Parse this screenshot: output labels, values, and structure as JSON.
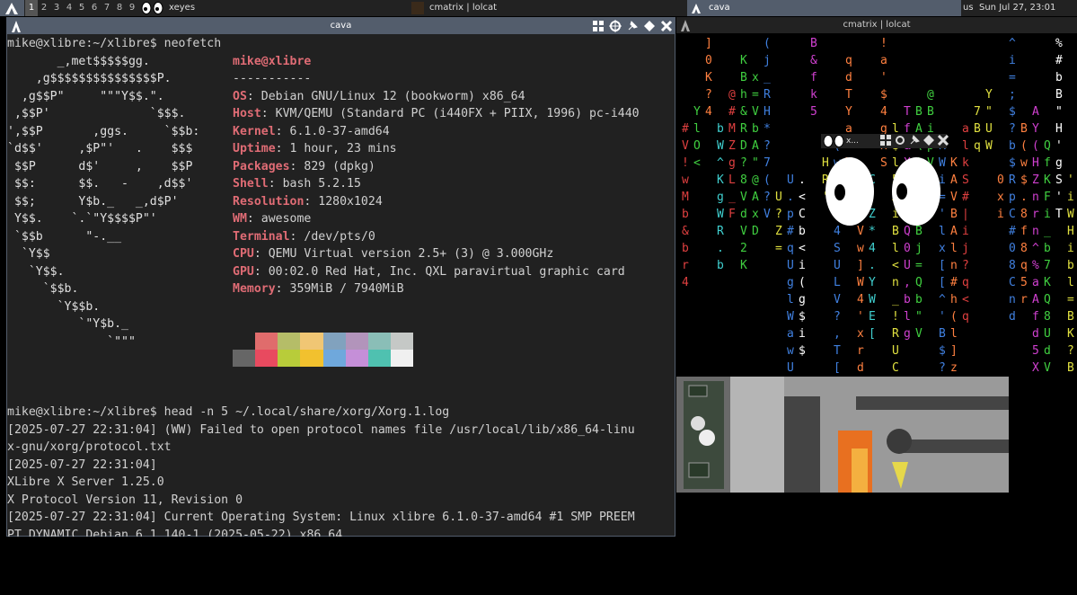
{
  "topbar": {
    "tags": [
      "1",
      "2",
      "3",
      "4",
      "5",
      "6",
      "7",
      "8",
      "9"
    ],
    "active_tag": "1",
    "xeyes_label": "xeyes",
    "task_center": "cmatrix | lolcat",
    "task_right": "cava",
    "keyboard": "us",
    "clock": "Sun Jul 27, 23:01"
  },
  "left_window": {
    "title": "cava",
    "prompt1": "mike@xlibre:~/xlibre$ neofetch",
    "ascii": [
      "       _,met$$$$$gg.",
      "    ,g$$$$$$$$$$$$$$$P.",
      "  ,g$$P\"     \"\"\"Y$$.\".",
      " ,$$P'              `$$$.",
      "',$$P       ,ggs.     `$$b:",
      "`d$$'     ,$P\"'   .    $$$",
      " $$P      d$'     ,    $$P",
      " $$:      $$.   -    ,d$$'",
      " $$;      Y$b._   _,d$P'",
      " Y$$.    `.`\"Y$$$$P\"'",
      " `$$b      \"-.__",
      "  `Y$$",
      "   `Y$$.",
      "     `$$b.",
      "       `Y$$b.",
      "          `\"Y$b._",
      "              `\"\"\""
    ],
    "user_host": "mike@xlibre",
    "separator": "-----------",
    "info": [
      {
        "key": "OS",
        "value": "Debian GNU/Linux 12 (bookworm) x86_64"
      },
      {
        "key": "Host",
        "value": "KVM/QEMU (Standard PC (i440FX + PIIX, 1996) pc-i440"
      },
      {
        "key": "Kernel",
        "value": "6.1.0-37-amd64"
      },
      {
        "key": "Uptime",
        "value": "1 hour, 23 mins"
      },
      {
        "key": "Packages",
        "value": "829 (dpkg)"
      },
      {
        "key": "Shell",
        "value": "bash 5.2.15"
      },
      {
        "key": "Resolution",
        "value": "1280x1024"
      },
      {
        "key": "WM",
        "value": "awesome"
      },
      {
        "key": "Terminal",
        "value": "/dev/pts/0"
      },
      {
        "key": "CPU",
        "value": "QEMU Virtual version 2.5+ (3) @ 3.000GHz"
      },
      {
        "key": "GPU",
        "value": "00:02.0 Red Hat, Inc. QXL paravirtual graphic card"
      },
      {
        "key": "Memory",
        "value": "359MiB / 7940MiB"
      }
    ],
    "palette_top": [
      "#212121",
      "#e06c6c",
      "#b5bd68",
      "#f0c674",
      "#81a2be",
      "#b294bb",
      "#8abeb7",
      "#c5c8c6"
    ],
    "palette_bottom": [
      "#666666",
      "#e84a5f",
      "#b8cc3a",
      "#f2c12e",
      "#6fa8dc",
      "#c58fd8",
      "#4fc1b0",
      "#f0f0f0"
    ],
    "prompt2": "mike@xlibre:~/xlibre$ head -n 5 ~/.local/share/xorg/Xorg.1.log",
    "log": [
      "[2025-07-27 22:31:04] (WW) Failed to open protocol names file /usr/local/lib/x86_64-linu",
      "x-gnu/xorg/protocol.txt",
      "[2025-07-27 22:31:04]",
      "XLibre X Server 1.25.0",
      "X Protocol Version 11, Revision 0",
      "[2025-07-27 22:31:04] Current Operating System: Linux xlibre 6.1.0-37-amd64 #1 SMP PREEM",
      "PT_DYNAMIC Debian 6.1.140-1 (2025-05-22) x86_64"
    ]
  },
  "matrix_window": {
    "title": "cmatrix | lolcat"
  },
  "xeyes_window": {
    "title": "x..."
  }
}
